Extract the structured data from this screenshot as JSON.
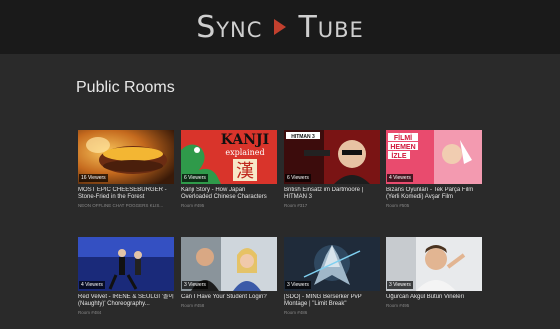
{
  "header": {
    "logo_left": "Sync",
    "logo_right": "Tube",
    "accent": "#c2402e"
  },
  "section_title": "Public Rooms",
  "rooms": [
    {
      "viewers": "16 Viewers",
      "title": "MOST EPIC CHEESEBURGER - Stone-Fried in the Forest",
      "sub": "NEON OFFLINE CHAT POGGERS KLIS..."
    },
    {
      "viewers": "6 Viewers",
      "title": "Kanji Story - How Japan Overloaded Chinese Characters",
      "sub": "Room #495",
      "thumb_text": "KANJI",
      "thumb_text2": "explained"
    },
    {
      "viewers": "6 Viewers",
      "title": "British Einsatz im Dartmoore | HITMAN 3",
      "sub": "Room #317",
      "thumb_text": "HITMAN 3"
    },
    {
      "viewers": "4 Viewers",
      "title": "Bizans Oyunları - Tek Parça Film (Yerli Komedi) Avşar Film",
      "sub": "Room #505",
      "thumb_text": "FİLMİ",
      "thumb_text2": "HEMEN",
      "thumb_text3": "İZLE"
    },
    {
      "viewers": "4 Viewers",
      "title": "Red Velvet - IRENE & SEULGI '놀이 (Naughty)' Choreography...",
      "sub": "Room #484"
    },
    {
      "viewers": "3 Viewers",
      "title": "Can I Have Your Student Login?",
      "sub": "Room #458"
    },
    {
      "viewers": "3 Viewers",
      "title": "[SDO] - MING Berserker PvP Montage | \"Limit Break\"",
      "sub": "Room #486"
    },
    {
      "viewers": "3 Viewers",
      "title": "Uğurcan Akgül Bütün Vineleri",
      "sub": "Room #495"
    }
  ]
}
